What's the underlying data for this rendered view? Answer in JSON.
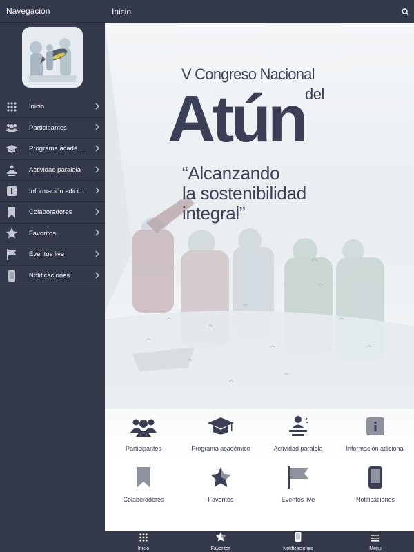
{
  "sidebar": {
    "title": "Navegación",
    "logo_icon": "tuna-fishing-logo",
    "items": [
      {
        "label": "Inicio",
        "icon": "grid-icon"
      },
      {
        "label": "Participantes",
        "icon": "people-icon"
      },
      {
        "label": "Programa académico",
        "icon": "graduation-cap-icon"
      },
      {
        "label": "Actividad paralela",
        "icon": "presenter-icon"
      },
      {
        "label": "Información adicional",
        "icon": "info-icon"
      },
      {
        "label": "Colaboradores",
        "icon": "bookmark-icon"
      },
      {
        "label": "Favoritos",
        "icon": "star-icon"
      },
      {
        "label": "Eventos live",
        "icon": "flag-icon"
      },
      {
        "label": "Notificaciones",
        "icon": "phone-icon"
      }
    ]
  },
  "header": {
    "title": "Inicio",
    "search_icon": "search-icon"
  },
  "hero": {
    "line1": "V Congreso Nacional",
    "line2": "del",
    "line3": "Atún",
    "quote": "“Alcanzando\nla sostenibilidad\nintegral”"
  },
  "grid": {
    "items": [
      {
        "label": "Participantes",
        "icon": "people-icon"
      },
      {
        "label": "Programa académico",
        "icon": "graduation-cap-icon"
      },
      {
        "label": "Actividad paralela",
        "icon": "presenter-icon"
      },
      {
        "label": "Información adicional",
        "icon": "info-icon"
      },
      {
        "label": "Colaboradores",
        "icon": "bookmark-icon"
      },
      {
        "label": "Favoritos",
        "icon": "star-icon"
      },
      {
        "label": "Eventos live",
        "icon": "flag-icon"
      },
      {
        "label": "Notificaciones",
        "icon": "phone-icon"
      }
    ]
  },
  "tabbar": {
    "tabs": [
      {
        "label": "Inicio",
        "icon": "grid-icon"
      },
      {
        "label": "Favoritos",
        "icon": "star-icon"
      },
      {
        "label": "Notificaciones",
        "icon": "phone-icon"
      },
      {
        "label": "Menu",
        "icon": "hamburger-icon"
      }
    ]
  },
  "colors": {
    "nav_bg": "#33384b",
    "text_dark": "#3c4057",
    "icon_light": "#c4c7d1"
  }
}
